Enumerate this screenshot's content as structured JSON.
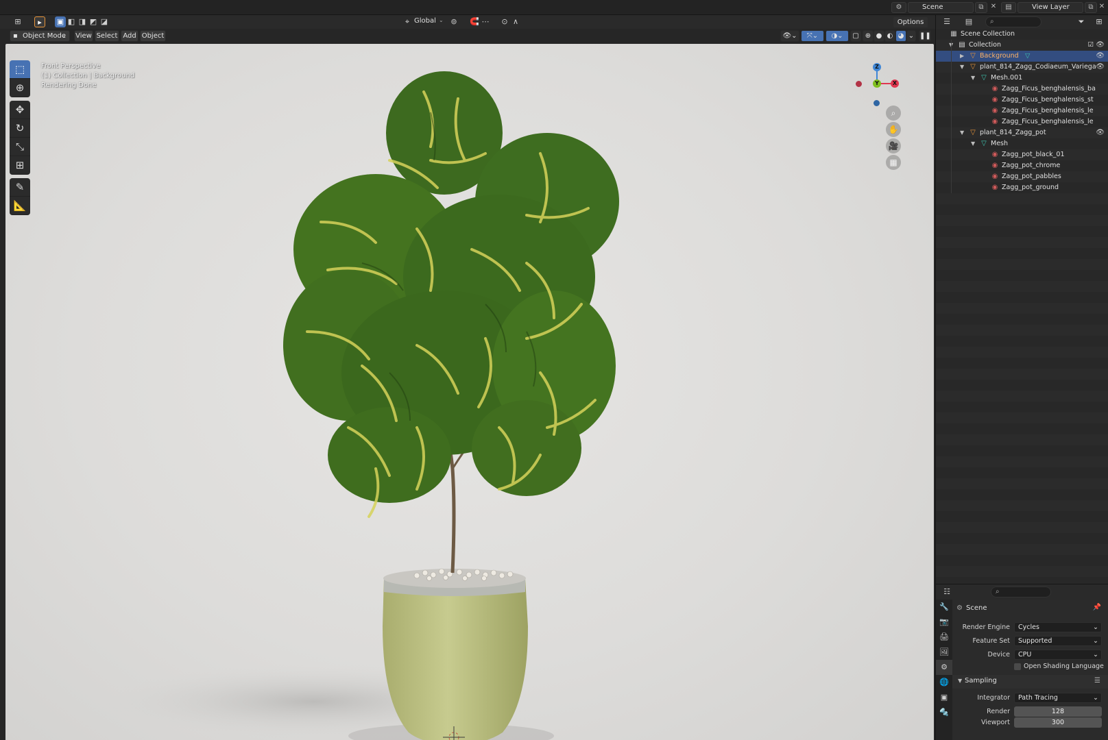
{
  "topbar": {
    "scene_name": "Scene",
    "view_layer_name": "View Layer"
  },
  "viewport_header": {
    "transform_orientation": "Global",
    "options_label": "Options",
    "mode_label": "Object Mode",
    "menus": [
      "View",
      "Select",
      "Add",
      "Object"
    ]
  },
  "viewport": {
    "info_line1": "Front Perspective",
    "info_line2": "(1) Collection | Background",
    "info_line3": "Rendering Done",
    "gizmo": {
      "z": "Z",
      "y": "Y",
      "x": "X"
    }
  },
  "outliner": {
    "rows": [
      {
        "label": "Scene Collection",
        "icon": "scene-collection-icon"
      },
      {
        "label": "Collection",
        "icon": "collection-icon"
      },
      {
        "label": "Background",
        "icon": "object-icon",
        "selected": true
      },
      {
        "label": "plant_814_Zagg_Codiaeum_Variega",
        "icon": "object-icon"
      },
      {
        "label": "Mesh.001",
        "icon": "mesh-icon"
      },
      {
        "label": "Zagg_Ficus_benghalensis_ba",
        "icon": "material-icon"
      },
      {
        "label": "Zagg_Ficus_benghalensis_st",
        "icon": "material-icon"
      },
      {
        "label": "Zagg_Ficus_benghalensis_le",
        "icon": "material-icon"
      },
      {
        "label": "Zagg_Ficus_benghalensis_le",
        "icon": "material-icon"
      },
      {
        "label": "plant_814_Zagg_pot",
        "icon": "object-icon"
      },
      {
        "label": "Mesh",
        "icon": "mesh-icon"
      },
      {
        "label": "Zagg_pot_black_01",
        "icon": "material-icon"
      },
      {
        "label": "Zagg_pot_chrome",
        "icon": "material-icon"
      },
      {
        "label": "Zagg_pot_pabbles",
        "icon": "material-icon"
      },
      {
        "label": "Zagg_pot_ground",
        "icon": "material-icon"
      }
    ]
  },
  "properties": {
    "context_title": "Scene",
    "render_engine_label": "Render Engine",
    "render_engine_value": "Cycles",
    "feature_set_label": "Feature Set",
    "feature_set_value": "Supported",
    "device_label": "Device",
    "device_value": "CPU",
    "osl_label": "Open Shading Language",
    "sampling_label": "Sampling",
    "integrator_label": "Integrator",
    "integrator_value": "Path Tracing",
    "render_label": "Render",
    "render_value": "128",
    "viewport_label": "Viewport",
    "viewport_value": "300"
  },
  "colors": {
    "accent": "#4772b3",
    "selected_row": "#334d80",
    "object_orange": "#e8953a",
    "mesh_teal": "#3fc4b0",
    "material_red": "#d05a5a",
    "gizmo_x": "#e0364f",
    "gizmo_y": "#7fbf1f",
    "gizmo_z": "#3f86d6"
  }
}
